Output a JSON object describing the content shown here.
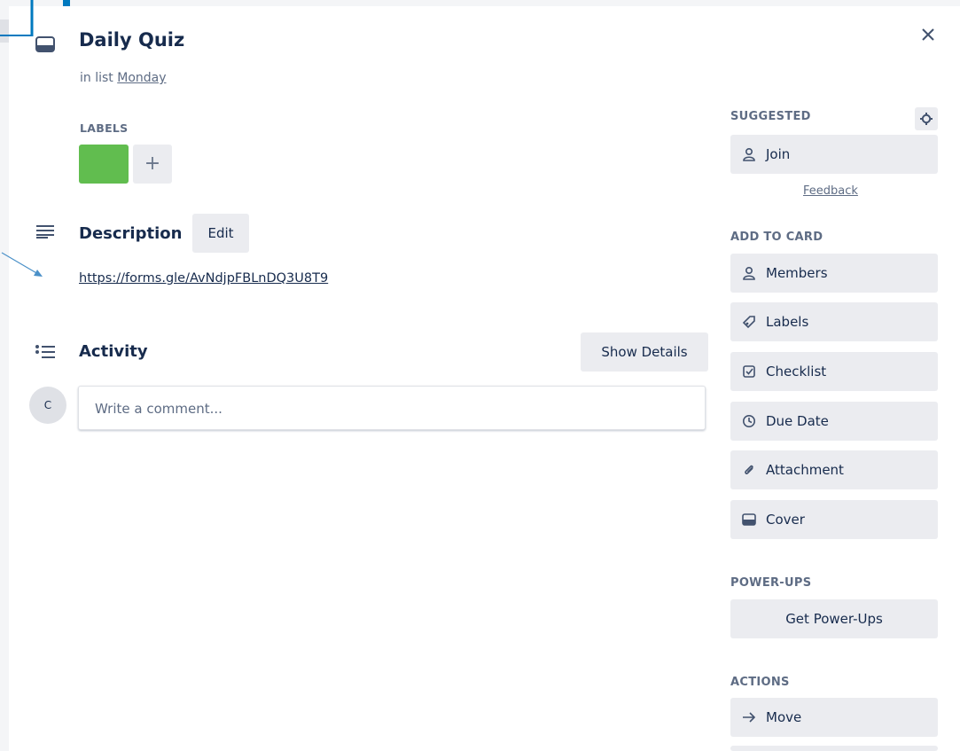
{
  "card": {
    "title": "Daily Quiz",
    "in_list_prefix": "in list",
    "list_name": "Monday"
  },
  "labels_section": {
    "heading": "LABELS",
    "label_color": "#61bd4f",
    "add_symbol": "+"
  },
  "description": {
    "heading": "Description",
    "edit_label": "Edit",
    "link_text": "https://forms.gle/AvNdjpFBLnDQ3U8T9"
  },
  "activity": {
    "heading": "Activity",
    "show_details_label": "Show Details",
    "avatar_initial": "C",
    "comment_placeholder": "Write a comment..."
  },
  "sidebar": {
    "suggested_heading": "SUGGESTED",
    "join_label": "Join",
    "feedback_label": "Feedback",
    "add_to_card_heading": "ADD TO CARD",
    "add_to_card_items": [
      {
        "label": "Members",
        "icon": "member-icon"
      },
      {
        "label": "Labels",
        "icon": "label-icon"
      },
      {
        "label": "Checklist",
        "icon": "checklist-icon"
      },
      {
        "label": "Due Date",
        "icon": "clock-icon"
      },
      {
        "label": "Attachment",
        "icon": "paperclip-icon"
      },
      {
        "label": "Cover",
        "icon": "cover-icon"
      }
    ],
    "power_ups_heading": "POWER-UPS",
    "get_power_ups_label": "Get Power-Ups",
    "actions_heading": "ACTIONS",
    "move_label": "Move"
  },
  "colors": {
    "accent": "#0079bf",
    "text": "#172b4d",
    "muted": "#5e6c84",
    "button_bg": "#ebecf0"
  }
}
